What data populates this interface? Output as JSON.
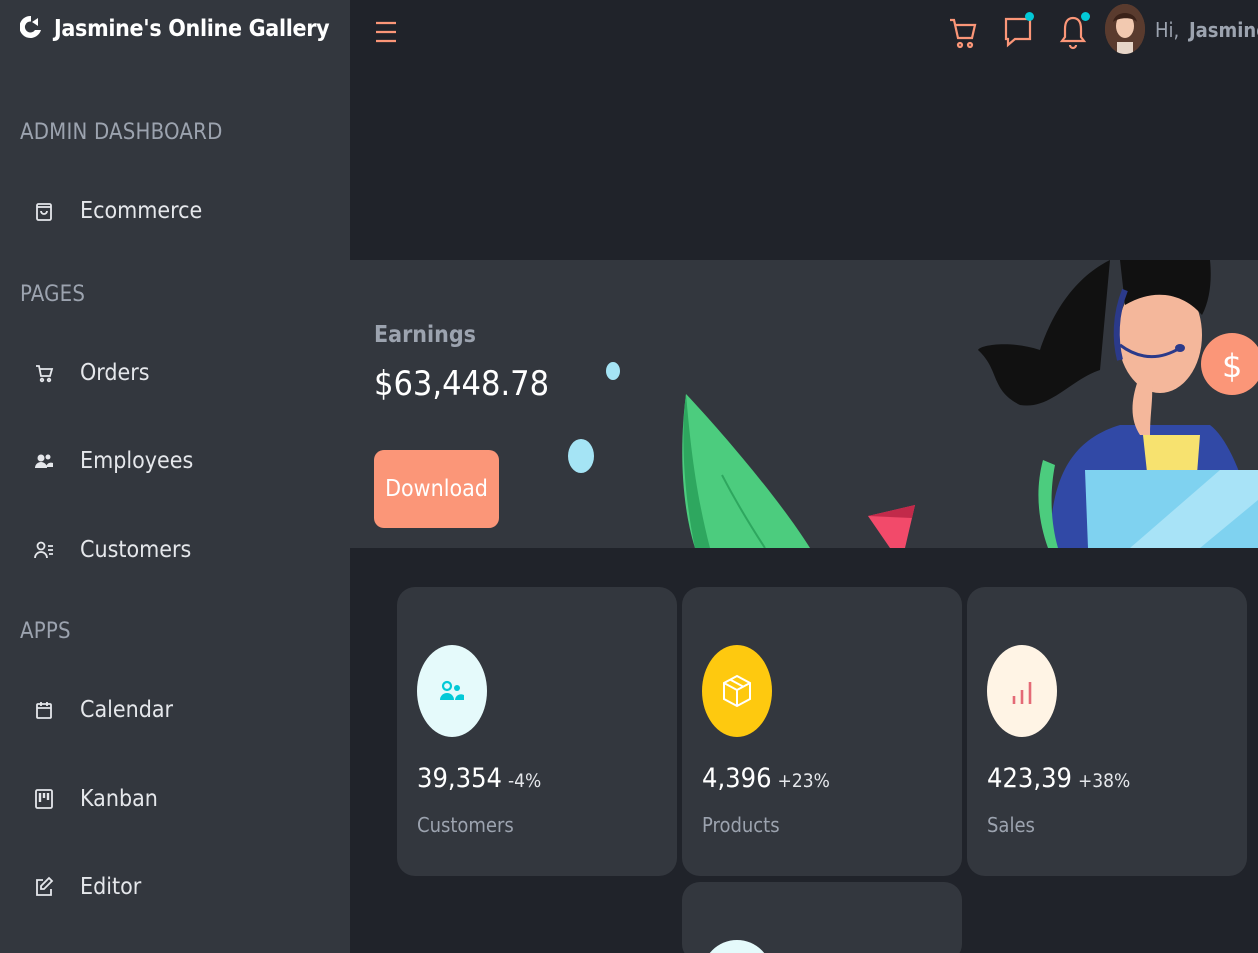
{
  "app": {
    "title": "Jasmine's Online Gallery"
  },
  "sidebar": {
    "sections": [
      {
        "title": "ADMIN DASHBOARD",
        "items": [
          {
            "label": "Ecommerce",
            "icon": "shopping-bag-icon"
          }
        ]
      },
      {
        "title": "PAGES",
        "items": [
          {
            "label": "Orders",
            "icon": "cart-icon"
          },
          {
            "label": "Employees",
            "icon": "people-icon"
          },
          {
            "label": "Customers",
            "icon": "person-lines-icon"
          }
        ]
      },
      {
        "title": "APPS",
        "items": [
          {
            "label": "Calendar",
            "icon": "calendar-icon"
          },
          {
            "label": "Kanban",
            "icon": "kanban-icon"
          },
          {
            "label": "Editor",
            "icon": "edit-icon"
          }
        ]
      }
    ]
  },
  "topbar": {
    "greeting": "Hi,",
    "user_name": "Jasmine",
    "icons": [
      "menu-icon",
      "cart-icon",
      "chat-icon",
      "bell-icon"
    ],
    "notification_color": "#03c9d7"
  },
  "earnings": {
    "label": "Earnings",
    "value": "$63,448.78",
    "download_label": "Download",
    "download_color": "#fb9678"
  },
  "stats": [
    {
      "amount": "39,354",
      "percentage": "-4%",
      "title": "Customers",
      "icon": "customers-icon",
      "icon_color": "#03c9d7",
      "icon_bg": "#e5fafb"
    },
    {
      "amount": "4,396",
      "percentage": "+23%",
      "title": "Products",
      "icon": "box-icon",
      "icon_color": "#ffffff",
      "icon_bg": "#fec90f"
    },
    {
      "amount": "423,39",
      "percentage": "+38%",
      "title": "Sales",
      "icon": "bar-chart-icon",
      "icon_color": "#e46a76",
      "icon_bg": "#fff4e5"
    }
  ],
  "theme": {
    "accent": "#fb9678",
    "sidebar_bg": "#33373e",
    "main_bg": "#20232a"
  }
}
